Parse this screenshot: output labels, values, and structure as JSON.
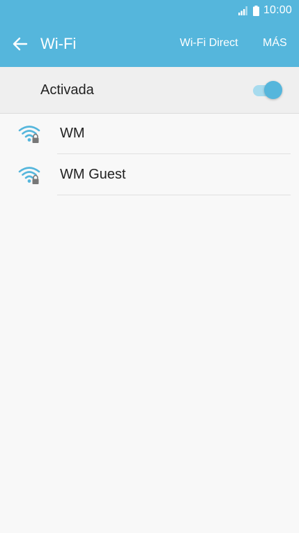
{
  "status_bar": {
    "time": "10:00",
    "icons": [
      "signal-icon",
      "battery-icon"
    ]
  },
  "app_bar": {
    "title": "Wi-Fi",
    "back_icon": "arrow-left-icon",
    "actions": {
      "wifi_direct": "Wi-Fi Direct",
      "more": "MÁS"
    }
  },
  "master_switch": {
    "label": "Activada",
    "on": true
  },
  "networks": [
    {
      "name": "WM",
      "icon": "wifi-locked-icon"
    },
    {
      "name": "WM Guest",
      "icon": "wifi-locked-icon"
    }
  ],
  "colors": {
    "accent": "#55b6dc",
    "toggle_track": "#a7dbee",
    "background": "#f8f8f8"
  }
}
